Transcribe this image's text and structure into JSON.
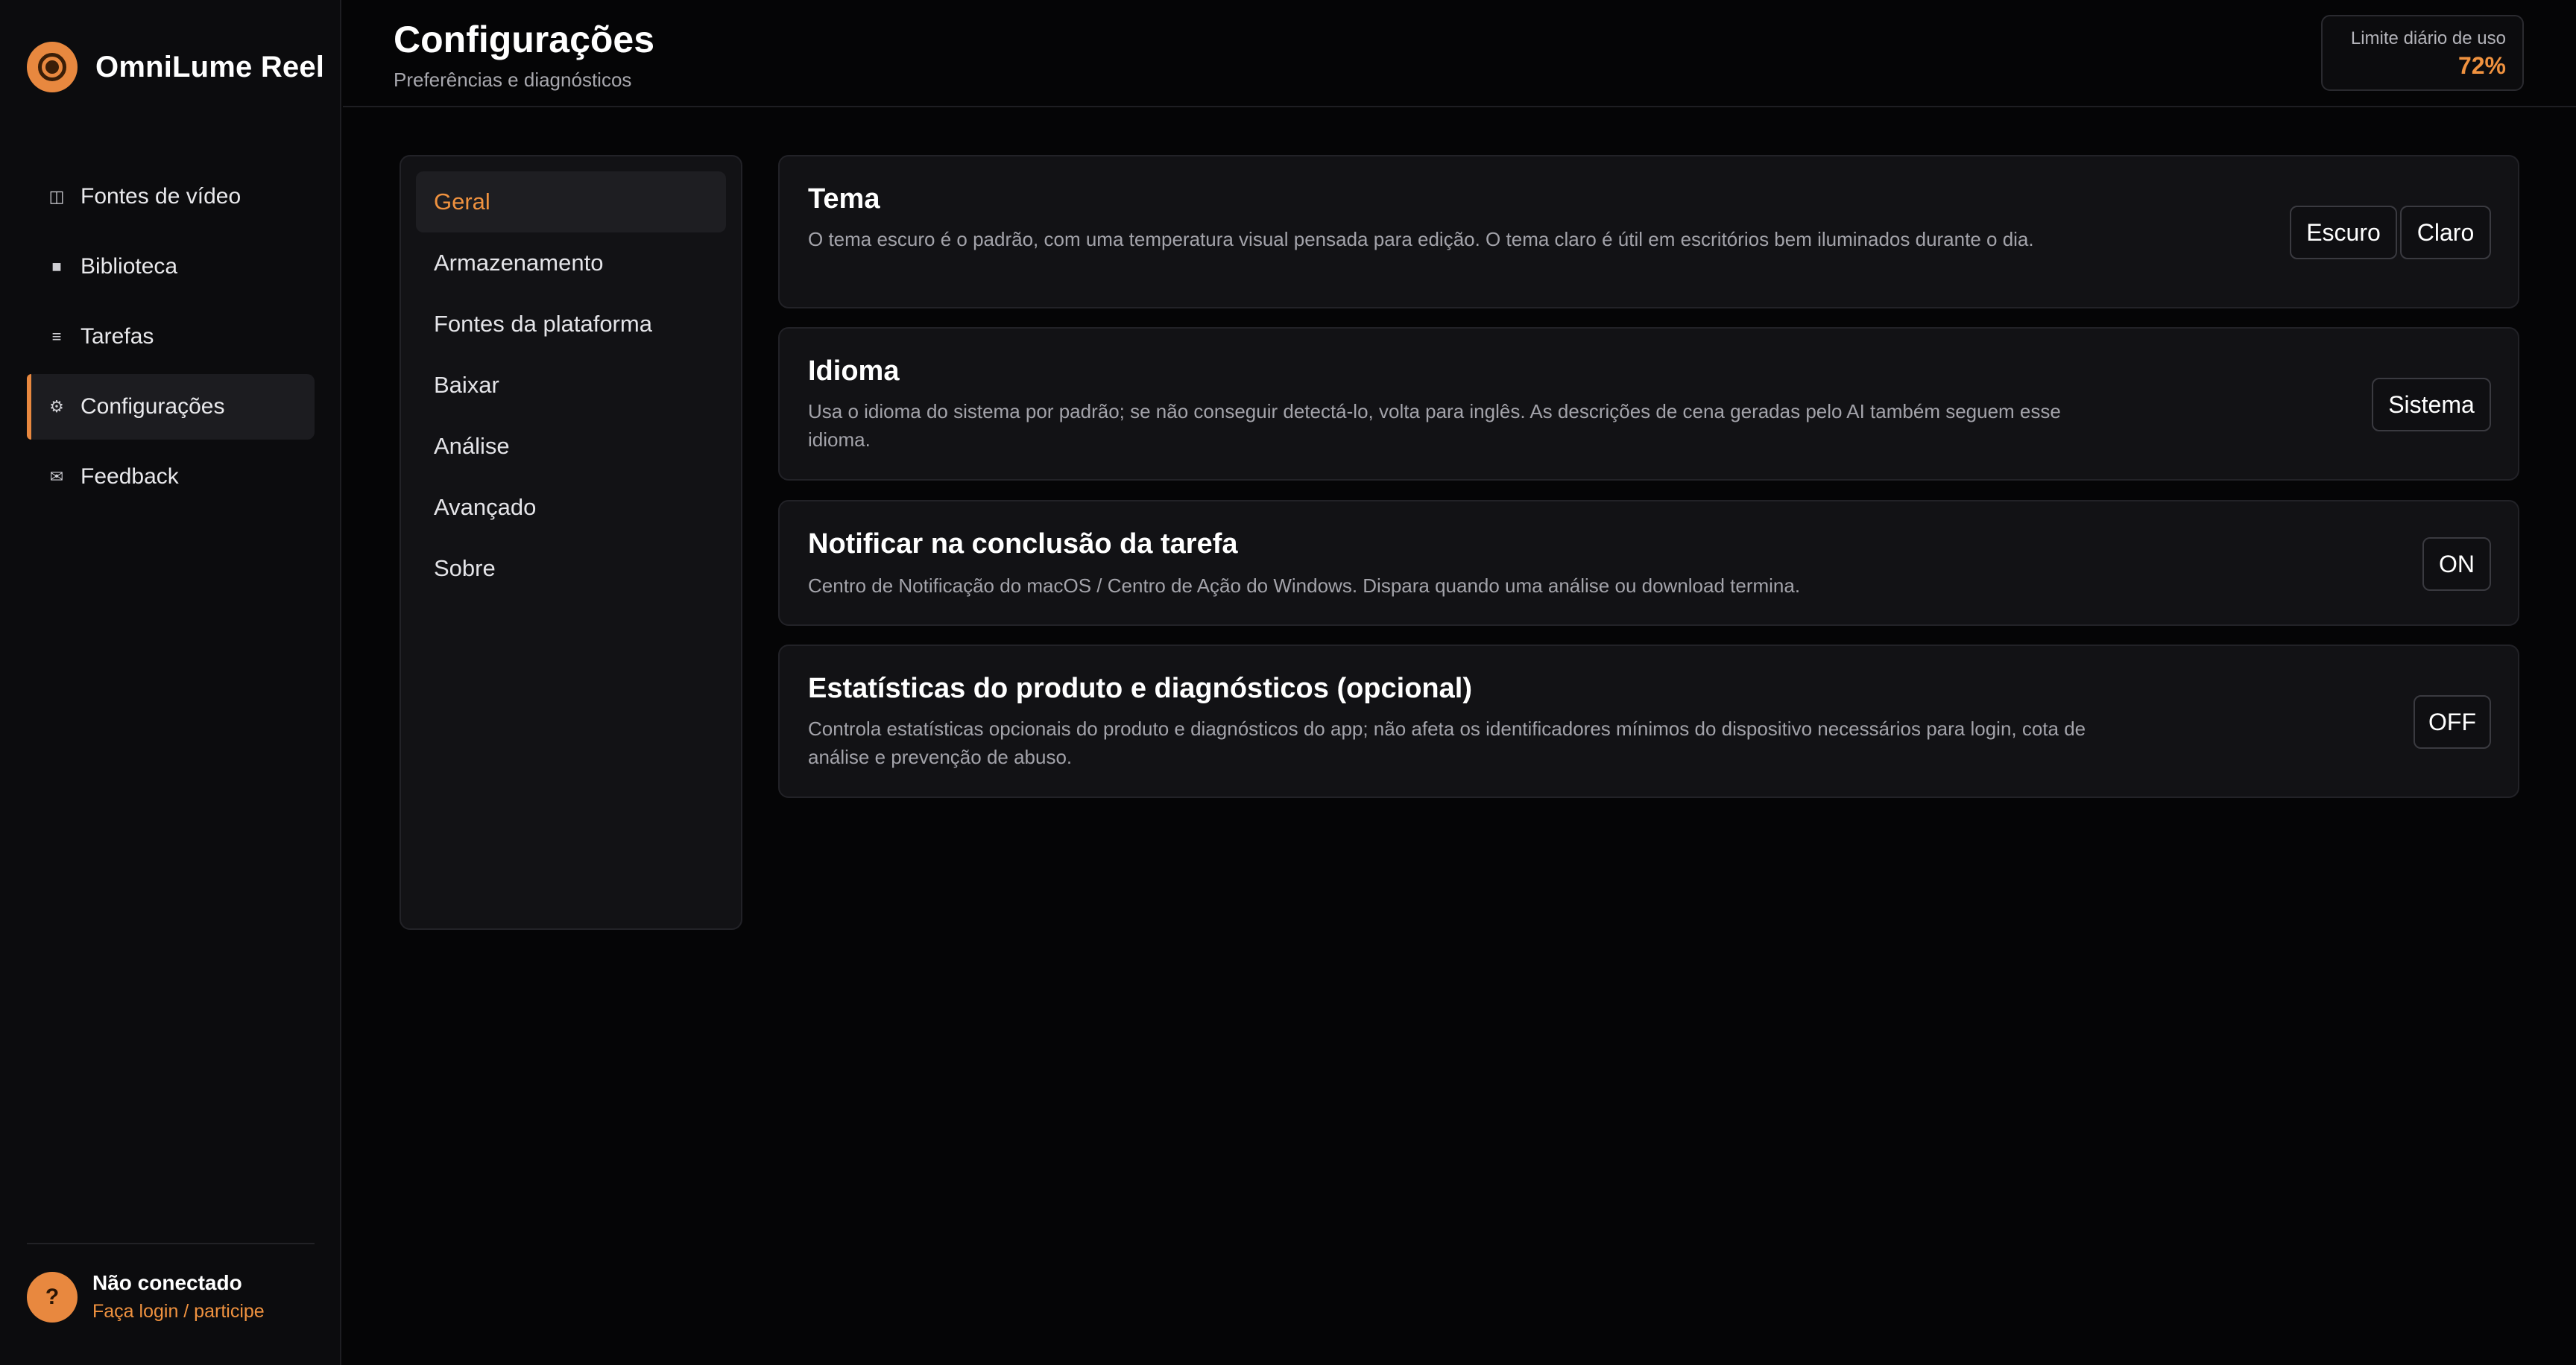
{
  "app": {
    "name": "OmniLume Reel"
  },
  "icons": {
    "brand": "logo-icon",
    "sources": "columns-icon",
    "library": "square-icon",
    "tasks": "list-icon",
    "settings": "gear-icon",
    "feedback": "envelope-icon",
    "account": "question-icon"
  },
  "colors": {
    "accent": "#e8883f",
    "background": "#050506",
    "panel": "#121215"
  },
  "sidebar": {
    "items": [
      {
        "label": "Fontes de vídeo",
        "icon": "◫"
      },
      {
        "label": "Biblioteca",
        "icon": "■"
      },
      {
        "label": "Tarefas",
        "icon": "≡"
      },
      {
        "label": "Configurações",
        "icon": "⚙"
      },
      {
        "label": "Feedback",
        "icon": "✉"
      }
    ],
    "active": "Configurações"
  },
  "account": {
    "avatar": "?",
    "status": "Não conectado",
    "link": "Faça login / participe"
  },
  "header": {
    "title": "Configurações",
    "subtitle": "Preferências e diagnósticos",
    "usage_label": "Limite diário de uso",
    "usage_value": "72%"
  },
  "settings_nav": {
    "items": [
      "Geral",
      "Armazenamento",
      "Fontes da plataforma",
      "Baixar",
      "Análise",
      "Avançado",
      "Sobre"
    ],
    "active": "Geral"
  },
  "cards": {
    "theme": {
      "title": "Tema",
      "desc": "O tema escuro é o padrão, com uma temperatura visual pensada para edição. O tema claro é útil em escritórios bem iluminados durante o dia.",
      "option_dark": "Escuro",
      "option_light": "Claro"
    },
    "language": {
      "title": "Idioma",
      "desc": "Usa o idioma do sistema por padrão; se não conseguir detectá-lo, volta para inglês. As descrições de cena geradas pelo AI também seguem esse idioma.",
      "value": "Sistema"
    },
    "notify": {
      "title": "Notificar na conclusão da tarefa",
      "desc": "Centro de Notificação do macOS / Centro de Ação do Windows. Dispara quando uma análise ou download termina.",
      "toggle": "ON"
    },
    "stats": {
      "title": "Estatísticas do produto e diagnósticos (opcional)",
      "desc": "Controla estatísticas opcionais do produto e diagnósticos do app; não afeta os identificadores mínimos do dispositivo necessários para login, cota de análise e prevenção de abuso.",
      "toggle": "OFF"
    }
  }
}
